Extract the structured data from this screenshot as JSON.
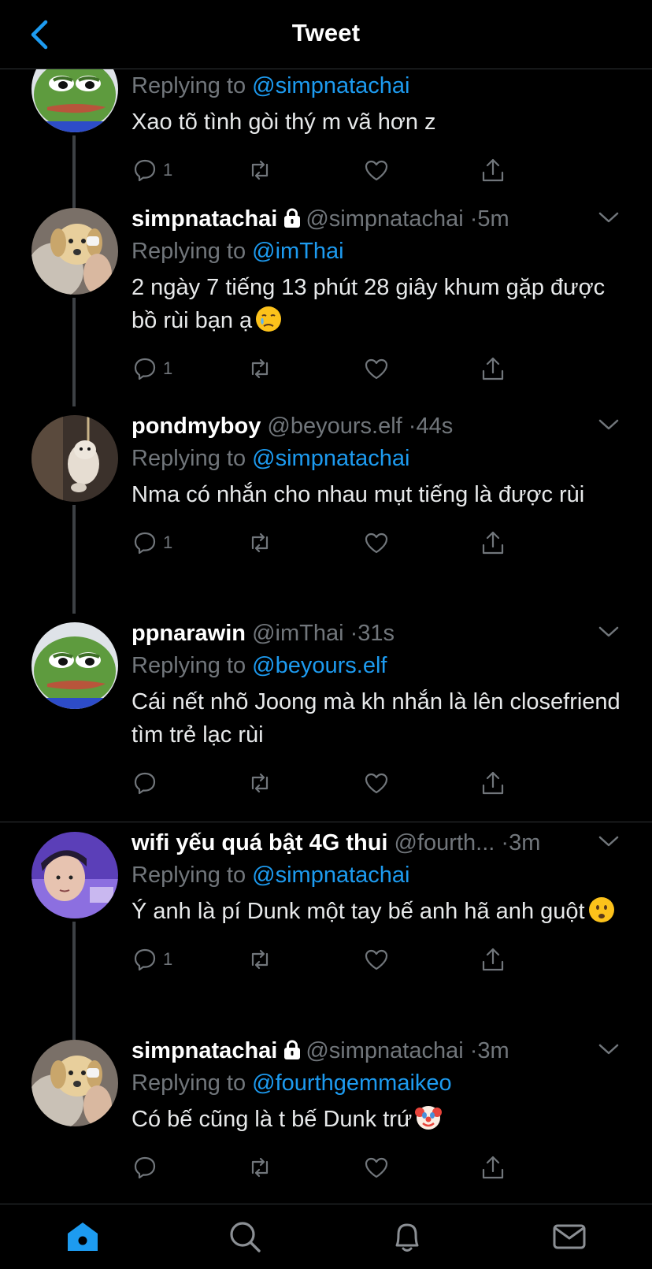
{
  "header": {
    "title": "Tweet"
  },
  "tweets": [
    {
      "name": "",
      "handle": "",
      "dot": "",
      "time": "",
      "locked": false,
      "replying_prefix": "Replying to",
      "replying_to": "@simpnatachai",
      "text": "Xao tõ tình gòi thý m vã hơn z",
      "reply_count": "1",
      "avatar": "pepe-frog"
    },
    {
      "name": "simpnatachai",
      "handle": "@simpnatachai",
      "dot": "·",
      "time": "5m",
      "locked": true,
      "replying_prefix": "Replying to",
      "replying_to": "@imThai",
      "text": "2 ngày 7 tiếng 13 phút 28 giây khum gặp được bồ rùi bạn ạ",
      "emoji": "crying-face",
      "reply_count": "1",
      "avatar": "puppy"
    },
    {
      "name": "pondmyboy",
      "handle": "@beyours.elf",
      "dot": "·",
      "time": "44s",
      "locked": false,
      "replying_prefix": "Replying to",
      "replying_to": "@simpnatachai",
      "text": "Nma có nhắn cho nhau mụt tiếng là được rùi",
      "reply_count": "1",
      "avatar": "hanging-cat"
    },
    {
      "name": "ppnarawin",
      "handle": "@imThai",
      "dot": "·",
      "time": "31s",
      "locked": false,
      "replying_prefix": "Replying to",
      "replying_to": "@beyours.elf",
      "text": "Cái nết nhõ Joong mà kh nhắn là lên closefriend tìm trẻ lạc rùi",
      "reply_count": "",
      "avatar": "pepe-frog"
    },
    {
      "name": "wifi yếu quá bật 4G thui",
      "handle": "@fourth...",
      "dot": "·",
      "time": "3m",
      "locked": false,
      "replying_prefix": "Replying to",
      "replying_to": "@simpnatachai",
      "text": "Ý anh là pí Dunk một tay bế anh hã anh guột",
      "emoji": "frowning-face",
      "reply_count": "1",
      "avatar": "person-purple"
    },
    {
      "name": "simpnatachai",
      "handle": "@simpnatachai",
      "dot": "·",
      "time": "3m",
      "locked": true,
      "replying_prefix": "Replying to",
      "replying_to": "@fourthgemmaikeo",
      "text": "Có bế cũng là t bế Dunk trứ",
      "emoji": "clown-face",
      "reply_count": "",
      "avatar": "puppy"
    }
  ],
  "tabbar": {
    "icons": [
      "home-icon",
      "search-icon",
      "notifications-icon",
      "messages-icon"
    ]
  },
  "colors": {
    "background": "#000000",
    "accent": "#1d9bf0",
    "muted": "#71767b",
    "separator": "#2f3336"
  }
}
